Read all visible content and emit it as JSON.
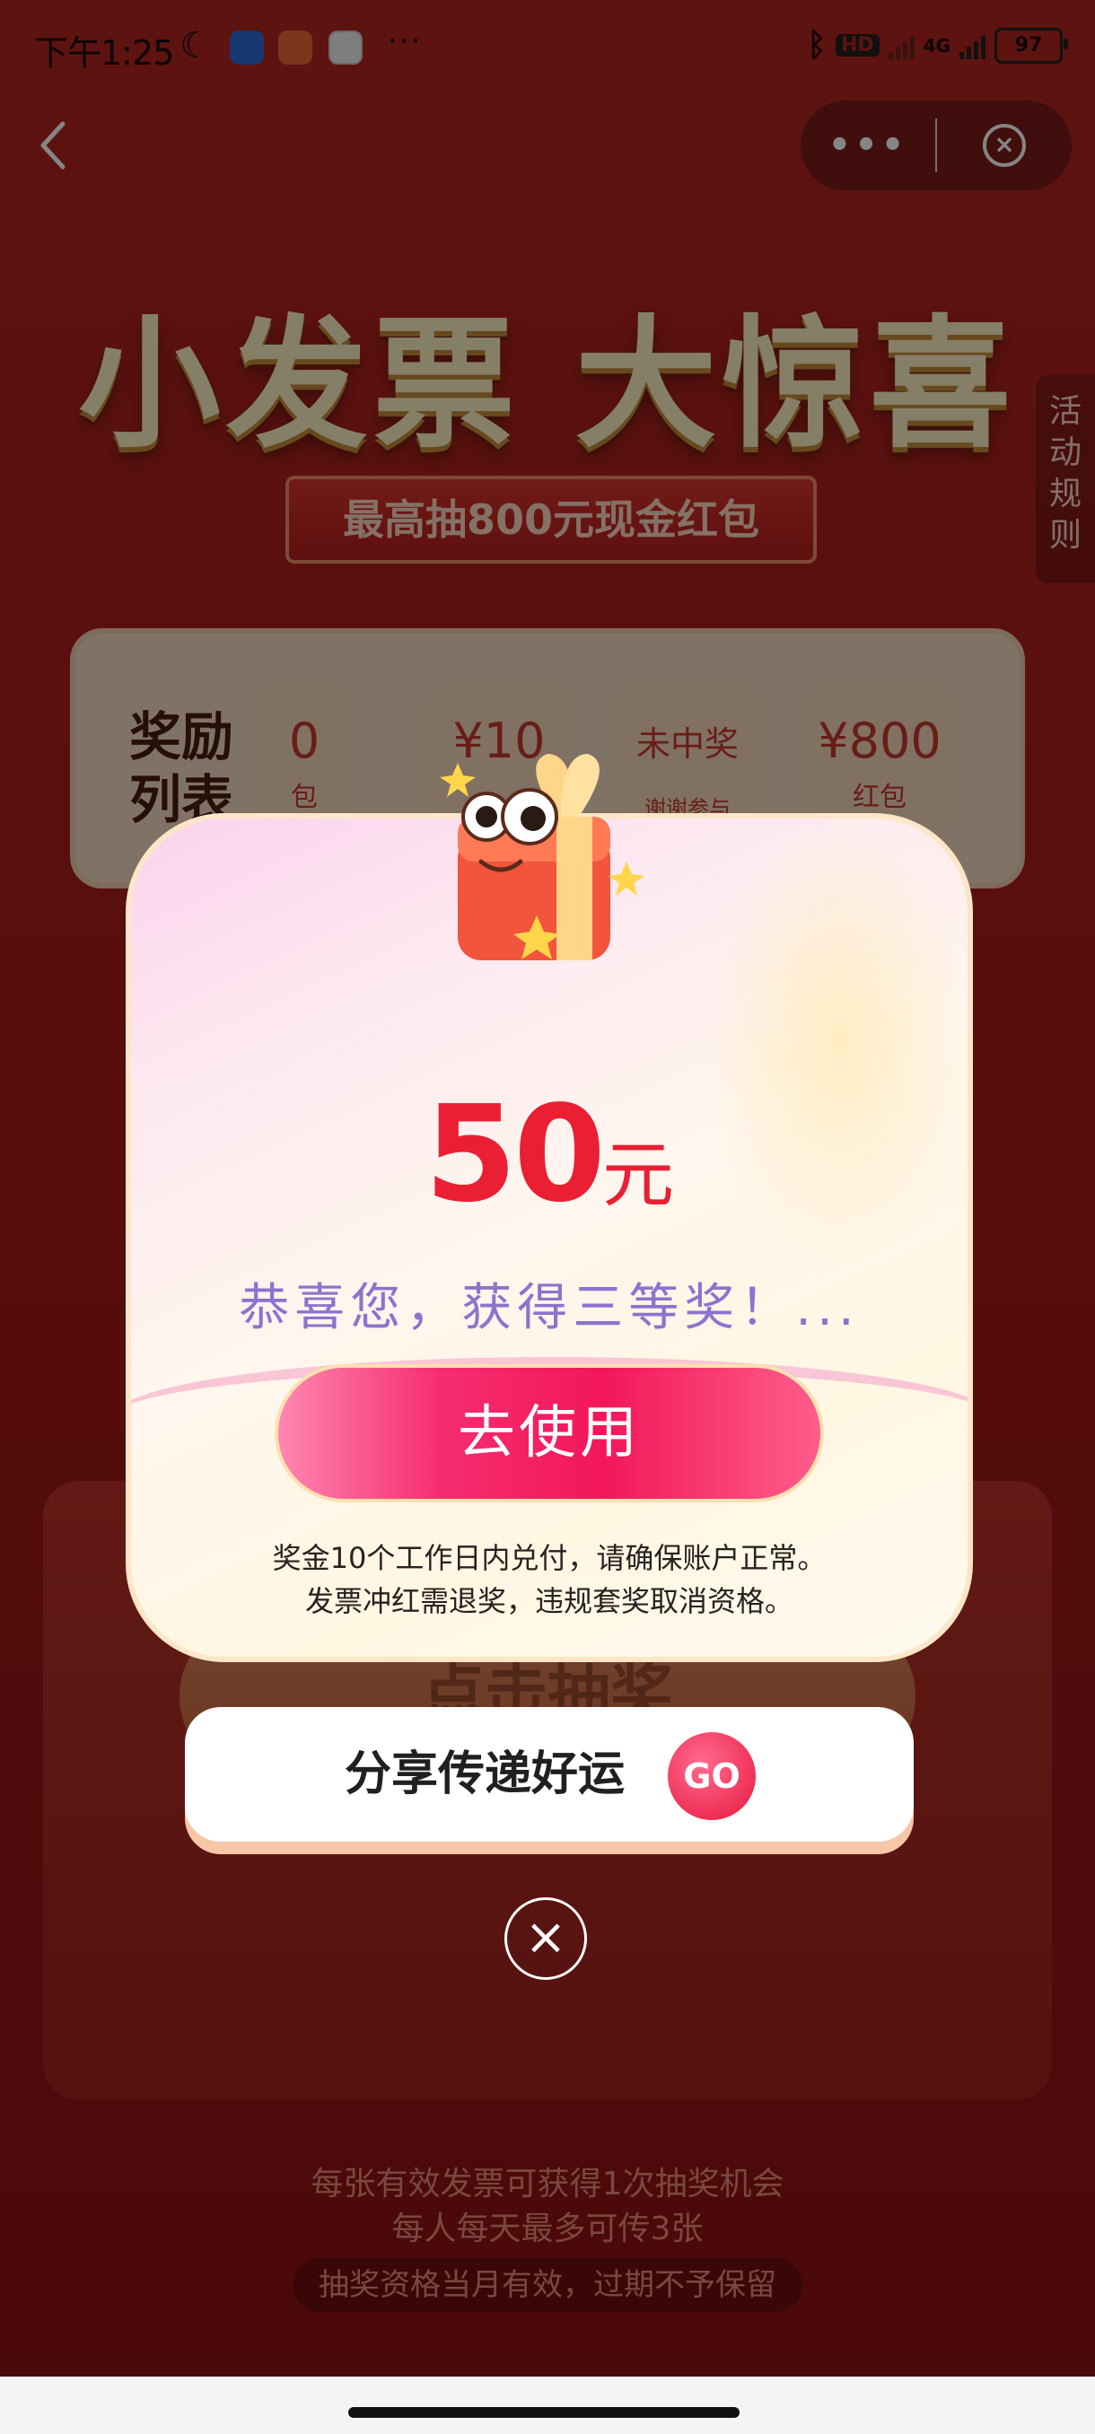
{
  "status_bar": {
    "time": "下午1:25",
    "moon_icon": "moon-icon",
    "more_dots": "···",
    "hd_label": "HD",
    "network_label": "4G",
    "battery": "97"
  },
  "nav": {
    "back_icon": "chevron-left-icon",
    "more_label": "•••",
    "close_icon": "close-circle-icon"
  },
  "hero": {
    "title": "小发票 大惊喜",
    "subtitle": "最高抽800元现金红包"
  },
  "rules_tab": {
    "label": "活动规则"
  },
  "prize_list": {
    "label": "奖励列表",
    "items": [
      {
        "value": "0",
        "unit": "包"
      },
      {
        "value": "¥10",
        "unit": ""
      },
      {
        "value": "未中奖",
        "unit": "谢谢参与"
      },
      {
        "value": "¥800",
        "unit": "红包"
      }
    ]
  },
  "machine": {
    "draw_label": "点击抽奖"
  },
  "modal": {
    "amount": "50",
    "amount_unit": "元",
    "congrats": "恭喜您，获得三等奖！...",
    "use_button": "去使用",
    "note_line1": "奖金10个工作日内兑付，请确保账户正常。",
    "note_line2": "发票冲红需退奖，违规套奖取消资格。"
  },
  "share": {
    "text": "分享传递好运",
    "go_label": "GO"
  },
  "footer": {
    "line1": "每张有效发票可获得1次抽奖机会",
    "line2": "每人每天最多可传3张",
    "pill": "抽奖资格当月有效，过期不予保留"
  },
  "colors": {
    "background": "#a81d1a",
    "accent": "#ea1f33",
    "button": "#f2175a",
    "congrats_text": "#8f72cc"
  }
}
